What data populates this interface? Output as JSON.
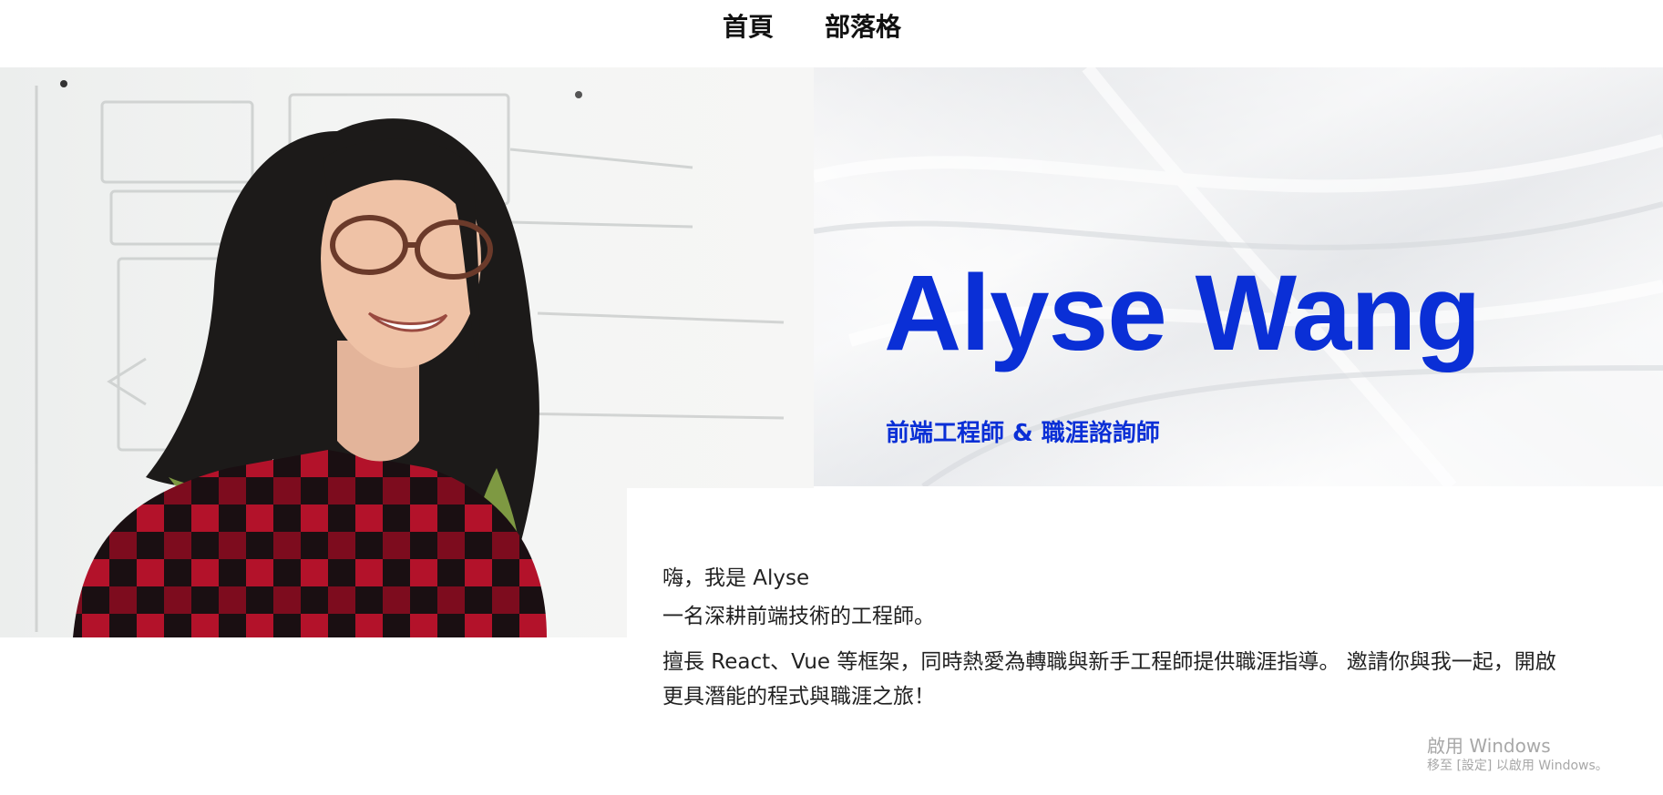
{
  "nav": {
    "home": "首頁",
    "blog": "部落格"
  },
  "hero": {
    "name": "Alyse Wang",
    "subtitle": "前端工程師 & 職涯諮詢師"
  },
  "intro": {
    "greeting": "嗨，我是 Alyse",
    "tagline": "一名深耕前端技術的工程師。",
    "description": "擅長 React、Vue 等框架，同時熱愛為轉職與新手工程師提供職涯指導。 邀請你與我一起，開啟更具潛能的程式與職涯之旅！"
  },
  "watermark": {
    "title": "啟用 Windows",
    "subtitle": "移至 [設定] 以啟用 Windows。"
  },
  "colors": {
    "accent": "#0a2fd6",
    "text": "#222222",
    "shirt_red": "#b3122a",
    "hair": "#1c1a19",
    "hair_tips": "#8fb04a"
  }
}
